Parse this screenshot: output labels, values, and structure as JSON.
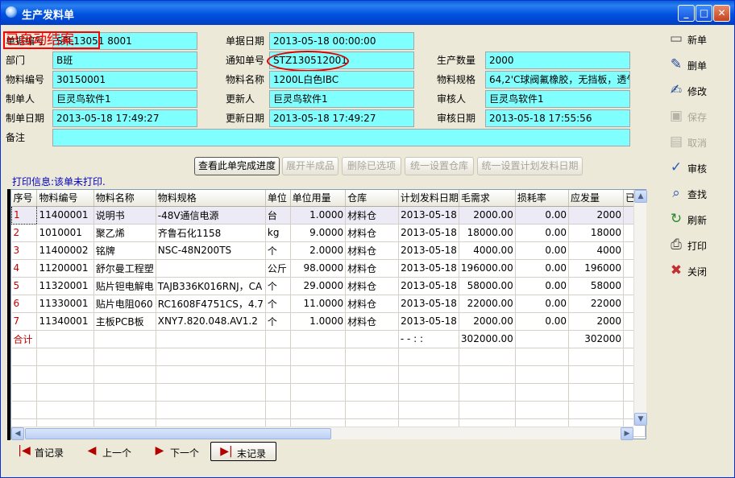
{
  "window": {
    "title": "生产发料单"
  },
  "stamp": "已自动结案",
  "form": {
    "doc_no_label": "单据编号",
    "doc_no": "SFL13051 8001",
    "doc_date_label": "单据日期",
    "doc_date": "2013-05-18 00:00:00",
    "dept_label": "部门",
    "dept": "B班",
    "notice_no_label": "通知单号",
    "notice_no": "STZ130512001",
    "qty_label": "生产数量",
    "qty": "2000",
    "item_code_label": "物料编号",
    "item_code": "30150001",
    "item_name_label": "物料名称",
    "item_name": "1200L白色IBC",
    "item_spec_label": "物料规格",
    "item_spec": "64,2'C球阀氟橡胶，无挡板，透气",
    "creator_label": "制单人",
    "creator": "巨灵鸟软件1",
    "updater_label": "更新人",
    "updater": "巨灵鸟软件1",
    "auditor_label": "审核人",
    "auditor": "巨灵鸟软件1",
    "create_date_label": "制单日期",
    "create_date": "2013-05-18 17:49:27",
    "update_date_label": "更新日期",
    "update_date": "2013-05-18 17:49:27",
    "audit_date_label": "审核日期",
    "audit_date": "2013-05-18 17:55:56",
    "remark_label": "备注",
    "remark": ""
  },
  "actions": {
    "progress": "查看此单完成进度",
    "expand": "展开半成品",
    "delete_selected": "删除已选项",
    "set_warehouse": "统一设置仓库",
    "set_date": "统一设置计划发料日期"
  },
  "print_info": "打印信息:该单未打印.",
  "grid": {
    "headers": [
      "序号",
      "物料编号",
      "物料名称",
      "物料规格",
      "单位",
      "单位用量",
      "仓库",
      "计划发料日期",
      "毛需求",
      "损耗率",
      "应发量",
      "已"
    ],
    "rows": [
      [
        "1",
        "11400001",
        "说明书",
        "-48V通信电源",
        "台",
        "1.0000",
        "材料仓",
        "2013-05-18",
        "2000.00",
        "0.00",
        "2000"
      ],
      [
        "2",
        "1010001",
        "聚乙烯",
        "齐鲁石化1158",
        "kg",
        "9.0000",
        "材料仓",
        "2013-05-18",
        "18000.00",
        "0.00",
        "18000"
      ],
      [
        "3",
        "11400002",
        "铭牌",
        "NSC-48N200TS",
        "个",
        "2.0000",
        "材料仓",
        "2013-05-18",
        "4000.00",
        "0.00",
        "4000"
      ],
      [
        "4",
        "11200001",
        "舒尔曼工程塑",
        "",
        "公斤",
        "98.0000",
        "材料仓",
        "2013-05-18",
        "196000.00",
        "0.00",
        "196000"
      ],
      [
        "5",
        "11320001",
        "贴片钽电解电",
        "TAJB336K016RNJ，CA",
        "个",
        "29.0000",
        "材料仓",
        "2013-05-18",
        "58000.00",
        "0.00",
        "58000"
      ],
      [
        "6",
        "11330001",
        "贴片电阻060",
        "RC1608F4751CS，4.7",
        "个",
        "11.0000",
        "材料仓",
        "2013-05-18",
        "22000.00",
        "0.00",
        "22000"
      ],
      [
        "7",
        "11340001",
        "主板PCB板",
        "XNY7.820.048.AV1.2",
        "个",
        "1.0000",
        "材料仓",
        "2013-05-18",
        "2000.00",
        "0.00",
        "2000"
      ]
    ],
    "total": {
      "label": "合计",
      "date": "- -   : :",
      "gross": "302000.00",
      "issue": "302000"
    }
  },
  "sidebar": [
    {
      "label": "新单",
      "icon": "new-doc-icon",
      "enabled": true
    },
    {
      "label": "删单",
      "icon": "delete-doc-icon",
      "enabled": true
    },
    {
      "label": "修改",
      "icon": "edit-icon",
      "enabled": true
    },
    {
      "label": "保存",
      "icon": "save-icon",
      "enabled": false
    },
    {
      "label": "取消",
      "icon": "cancel-icon",
      "enabled": false
    },
    {
      "label": "审核",
      "icon": "audit-icon",
      "enabled": true
    },
    {
      "label": "查找",
      "icon": "search-icon",
      "enabled": true
    },
    {
      "label": "刷新",
      "icon": "refresh-icon",
      "enabled": true
    },
    {
      "label": "打印",
      "icon": "print-icon",
      "enabled": true
    },
    {
      "label": "关闭",
      "icon": "close-icon",
      "enabled": true
    }
  ],
  "nav": {
    "first": "首记录",
    "prev": "上一个",
    "next": "下一个",
    "last": "末记录"
  },
  "colors": {
    "field_bg": "#80ffff",
    "accent_red": "#ff0000",
    "title_blue": "#0053e0"
  }
}
